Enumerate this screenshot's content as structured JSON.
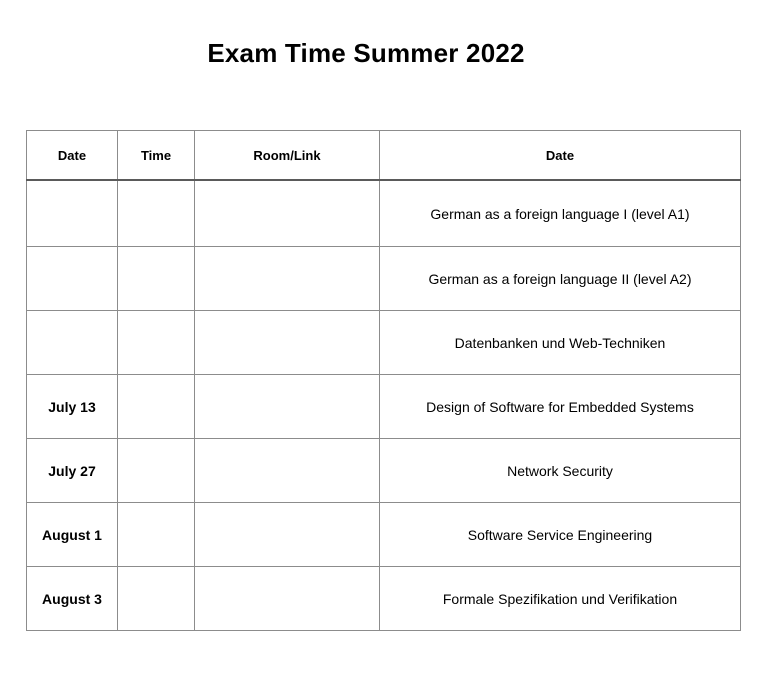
{
  "document": {
    "title": "Exam Time Summer 2022"
  },
  "table": {
    "headers": {
      "date": "Date",
      "time": "Time",
      "room": "Room/Link",
      "course": "Date"
    },
    "rows": [
      {
        "date": "",
        "time": "",
        "room": "",
        "course": "German as a foreign language I (level A1)"
      },
      {
        "date": "",
        "time": "",
        "room": "",
        "course": "German as a foreign language II (level A2)"
      },
      {
        "date": "",
        "time": "",
        "room": "",
        "course": "Datenbanken und Web-Techniken"
      },
      {
        "date": "July 13",
        "time": "",
        "room": "",
        "course": "Design of Software for Embedded Systems"
      },
      {
        "date": "July 27",
        "time": "",
        "room": "",
        "course": "Network Security"
      },
      {
        "date": "August 1",
        "time": "",
        "room": "",
        "course": "Software Service Engineering"
      },
      {
        "date": "August 3",
        "time": "",
        "room": "",
        "course": "Formale Spezifikation und Verifikation"
      }
    ]
  }
}
